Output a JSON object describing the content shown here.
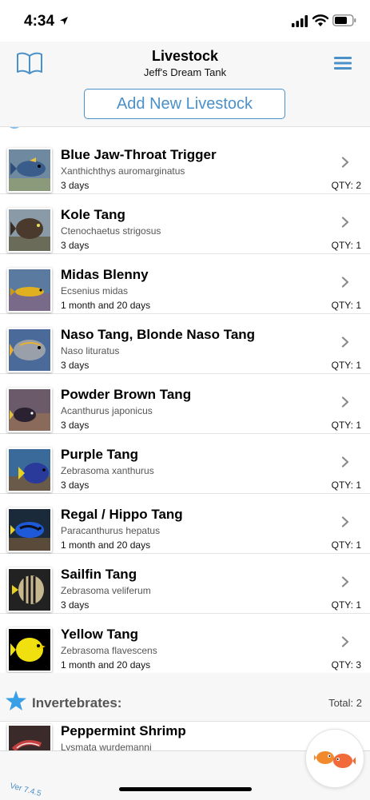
{
  "status_bar": {
    "time": "4:34"
  },
  "header": {
    "title": "Livestock",
    "subtitle": "Jeff's Dream Tank",
    "add_button": "Add New Livestock"
  },
  "livestock": [
    {
      "name": "Blue Jaw-Throat Trigger",
      "scientific": "Xanthichthys auromarginatus",
      "age": "3 days",
      "qty": "QTY: 2"
    },
    {
      "name": "Kole Tang",
      "scientific": "Ctenochaetus strigosus",
      "age": "3 days",
      "qty": "QTY: 1"
    },
    {
      "name": "Midas Blenny",
      "scientific": "Ecsenius midas",
      "age": "1 month and 20 days",
      "qty": "QTY: 1"
    },
    {
      "name": "Naso Tang, Blonde Naso Tang",
      "scientific": "Naso lituratus",
      "age": "3 days",
      "qty": "QTY: 1"
    },
    {
      "name": "Powder Brown Tang",
      "scientific": "Acanthurus japonicus",
      "age": "3 days",
      "qty": "QTY: 1"
    },
    {
      "name": "Purple Tang",
      "scientific": "Zebrasoma xanthurus",
      "age": "3 days",
      "qty": "QTY: 1"
    },
    {
      "name": "Regal / Hippo Tang",
      "scientific": "Paracanthurus hepatus",
      "age": "1 month and 20 days",
      "qty": "QTY: 1"
    },
    {
      "name": "Sailfin Tang",
      "scientific": "Zebrasoma veliferum",
      "age": "3 days",
      "qty": "QTY: 1"
    },
    {
      "name": "Yellow Tang",
      "scientific": "Zebrasoma flavescens",
      "age": "1 month and 20 days",
      "qty": "QTY: 3"
    }
  ],
  "invertebrates": {
    "label": "Invertebrates:",
    "total": "Total: 2",
    "items": [
      {
        "name": "Peppermint Shrimp",
        "scientific": "Lysmata wurdemanni"
      }
    ]
  },
  "footer": {
    "version": "Ver 7.4.5"
  },
  "colors": {
    "accent": "#4a90c9",
    "star": "#3aa0e6",
    "fish_orange": "#f08a2c"
  },
  "icons": [
    "location-arrow-icon",
    "signal-icon",
    "wifi-icon",
    "battery-icon",
    "book-icon",
    "menu-icon",
    "chevron-right-icon",
    "starfish-icon",
    "fish-icon"
  ]
}
